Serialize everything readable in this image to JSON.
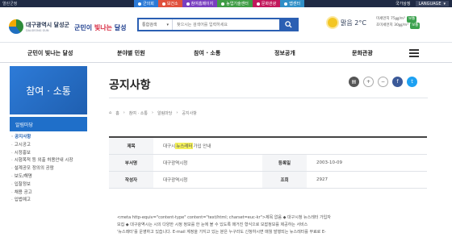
{
  "topbar": {
    "left_items": [
      "열린군정"
    ],
    "tabs": [
      {
        "label": "군의회",
        "color": "#2c7ad6"
      },
      {
        "label": "보건소",
        "color": "#e0513d"
      },
      {
        "label": "참여홈페이지",
        "color": "#7a3fc0"
      },
      {
        "label": "농업기술센터",
        "color": "#3f9c45"
      },
      {
        "label": "문화관광",
        "color": "#c2185b"
      },
      {
        "label": "맵센터",
        "color": "#2f8fc7"
      },
      {
        "label": "국가상징",
        "color": "#1f2a44"
      }
    ],
    "language": "LANGUAGE"
  },
  "header": {
    "logo_ko": "대구광역시 달성군",
    "logo_en": "DALSEONG GUN",
    "slogan_pre": "군민이 ",
    "slogan_hl": "빛나는",
    "slogan_post": " 달성",
    "search_category": "통합검색",
    "search_placeholder": "찾으시는 검색어를 입력하세요",
    "weather": "맑음 2°C",
    "air1_label": "미세먼지",
    "air1_value": "75㎍/m³",
    "air1_level": "보통",
    "air2_label": "초미세먼지",
    "air2_value": "30㎍/m³",
    "air2_level": "보통"
  },
  "nav": {
    "items": [
      "군민이 빛나는 달성",
      "분야별 민원",
      "참여 · 소통",
      "정보공개",
      "문화관광"
    ]
  },
  "sidebar": {
    "title": "참여 · 소통",
    "subtitle": "알림마당",
    "items": [
      {
        "label": "공지사항",
        "active": true
      },
      {
        "label": "고시공고",
        "active": false
      },
      {
        "label": "시정홍보",
        "active": false
      },
      {
        "label": "시험목적 등 외출 허용안내 시장",
        "active": false
      },
      {
        "label": "설계공모 정의의 공람",
        "active": false
      },
      {
        "label": "보도/해명",
        "active": false
      },
      {
        "label": "입찰정보",
        "active": false
      },
      {
        "label": "채용 공고",
        "active": false
      },
      {
        "label": "입법예고",
        "active": false
      }
    ]
  },
  "content": {
    "title": "공지사항",
    "breadcrumb": [
      "홈",
      "참여 · 소통",
      "알림마당",
      "공지사항"
    ],
    "table": {
      "subject_label": "제목",
      "subject_pre": "대구시 ",
      "subject_hl": "뉴스레터",
      "subject_post": " 가입 안내",
      "dept_label": "부서명",
      "dept_value": "대구광역시청",
      "date_label": "등록일",
      "date_value": "2003-10-09",
      "author_label": "작성자",
      "author_value": "대구광역시청",
      "views_label": "조회",
      "views_value": "2927"
    },
    "body_lines": [
      "<meta http-equiv=\"content-type\" content=\"text/html; charset=euc-kr\">제목 없음          ◆ 대구시청 뉴스레터       가입자",
      "모집 ◆          대구광역시는 시의 다양한 시정 정보를 한 눈에 볼 수 있도록 매거진       형식으로 모잡정보를 제공하는 서비스",
      "'뉴스레터'를 운영하고 있습니다.        E-mail 계정을 가지고 있는 분은 누구라도 신청하시면 매월 발행되는      뉴스레터를 무료로 E-"
    ]
  },
  "colors": {
    "topbar_bg": "#1f2a44",
    "accent": "#1f5fb0",
    "highlight": "#f4f15a"
  }
}
